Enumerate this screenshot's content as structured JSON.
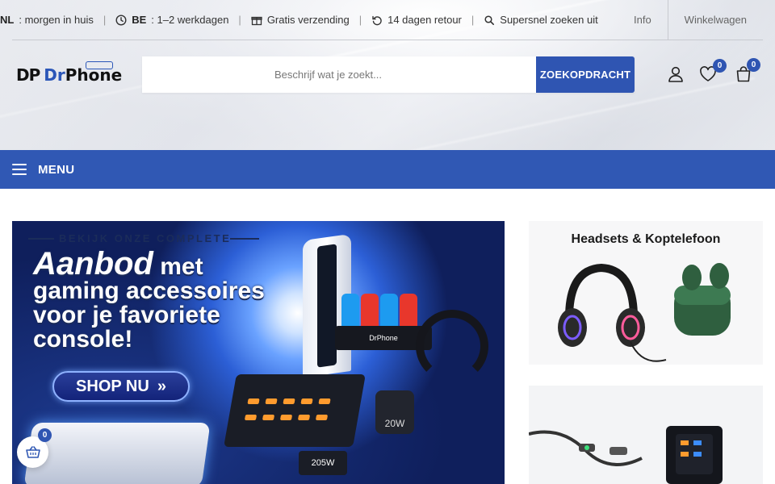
{
  "topbar": {
    "nl_label": "NL",
    "nl_text": ": morgen in huis",
    "be_label": "BE",
    "be_text": ": 1–2 werkdagen",
    "shipping": "Gratis verzending",
    "returns": "14 dagen retour",
    "search_text": "Supersnel zoeken uit",
    "separator": "|",
    "links": [
      "Info",
      "Winkelwagen"
    ]
  },
  "logo": {
    "mark": "DP",
    "word_prefix": "Dr",
    "word_suffix": "Phone"
  },
  "search": {
    "placeholder": "Beschrijf wat je zoekt...",
    "button_label": "ZOEKOPDRACHT"
  },
  "header_icons": {
    "wishlist_count": "0",
    "cart_count": "0"
  },
  "menu": {
    "label": "MENU"
  },
  "hero": {
    "kicker": "BEKIJK ONZE COMPLETE",
    "headline_emph": "Aanbod",
    "headline_rest1": " met",
    "headline_line2": "gaming accessoires",
    "headline_line3": "voor je favoriete",
    "headline_line4": "console!",
    "cta_label": "SHOP NU",
    "cta_icon": "»",
    "dock_brand": "DrPhone",
    "plug_label": "20W",
    "charger_label": "205W"
  },
  "side_banners": [
    {
      "title": "Headsets & Koptelefoon"
    },
    {
      "title": ""
    }
  ],
  "float_cart": {
    "count": "0"
  },
  "colors": {
    "primary": "#3058b4",
    "button": "#2f55b2"
  }
}
